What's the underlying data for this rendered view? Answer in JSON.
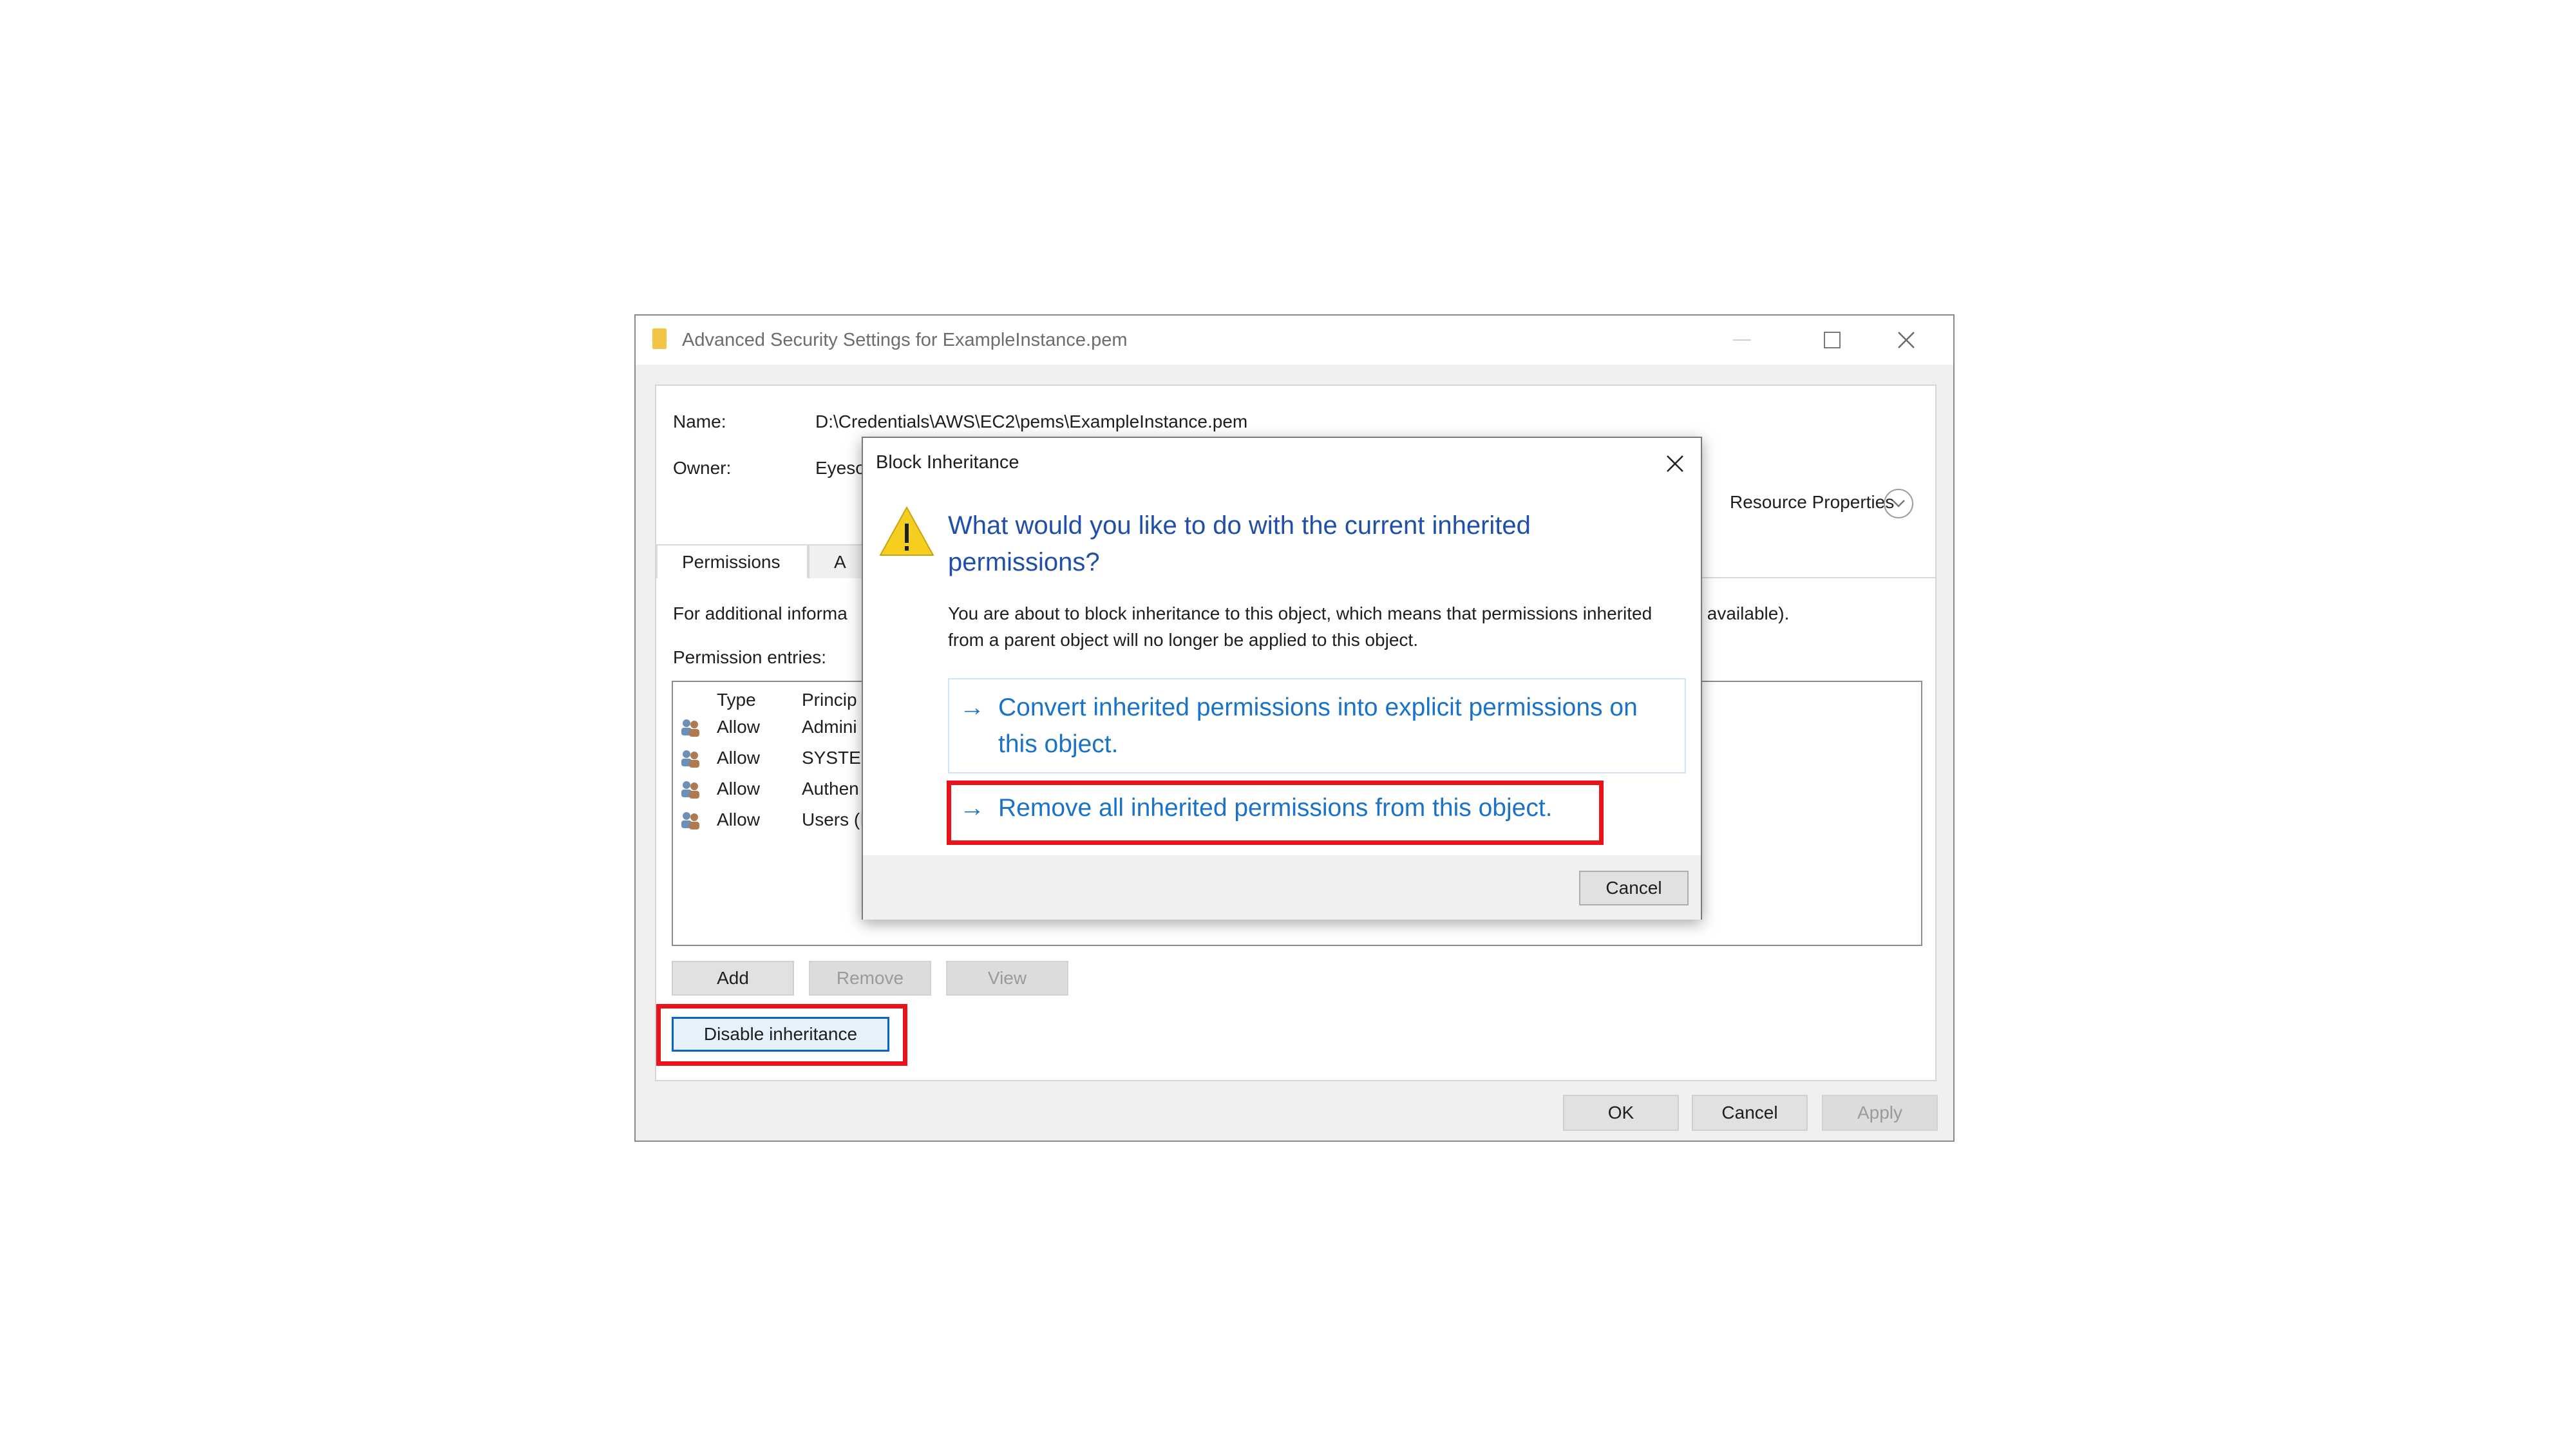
{
  "window": {
    "title": "Advanced Security Settings for ExampleInstance.pem"
  },
  "details": {
    "name_label": "Name:",
    "name_value": "D:\\Credentials\\AWS\\EC2\\pems\\ExampleInstance.pem",
    "owner_label": "Owner:",
    "owner_value": "Eyeso",
    "resource_properties": "Resource Properties"
  },
  "tabs": [
    {
      "label": "Permissions"
    },
    {
      "label": "A"
    }
  ],
  "info_text": "For additional informa",
  "info_text_tail": "if available).",
  "permission_entries_label": "Permission entries:",
  "perm_table": {
    "headers": [
      "Type",
      "Princip"
    ],
    "rows": [
      {
        "type": "Allow",
        "principal": "Admini"
      },
      {
        "type": "Allow",
        "principal": "SYSTEM"
      },
      {
        "type": "Allow",
        "principal": "Authen"
      },
      {
        "type": "Allow",
        "principal": "Users (I"
      }
    ]
  },
  "buttons": {
    "add": "Add",
    "remove": "Remove",
    "view": "View",
    "disable_inheritance": "Disable inheritance",
    "ok": "OK",
    "cancel": "Cancel",
    "apply": "Apply"
  },
  "dialog": {
    "title": "Block Inheritance",
    "question": "What would you like to do with the current inherited permissions?",
    "body": "You are about to block inheritance to this object, which means that permissions inherited from a parent object will no longer be applied to this object.",
    "option_convert": "Convert inherited permissions into explicit permissions on this object.",
    "option_remove": "Remove all inherited permissions from this object.",
    "cancel": "Cancel"
  },
  "colors": {
    "highlight": "#e8141a",
    "link_blue": "#1a73c9",
    "question_blue": "#1f4fa8"
  }
}
